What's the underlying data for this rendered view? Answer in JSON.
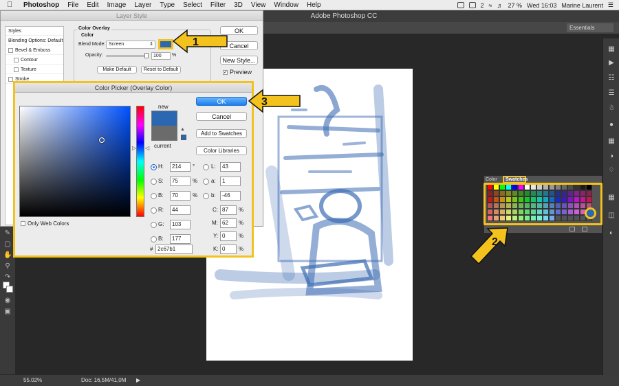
{
  "menubar": {
    "app": "Photoshop",
    "items": [
      "File",
      "Edit",
      "Image",
      "Layer",
      "Type",
      "Select",
      "Filter",
      "3D",
      "View",
      "Window",
      "Help"
    ],
    "battery": "27 %",
    "clock": "Wed 16:03",
    "user": "Marine Laurent",
    "badge": "2"
  },
  "ps": {
    "title": "Adobe Photoshop CC",
    "workspace": "Essentials",
    "status_zoom": "55.02%",
    "status_doc": "Doc: 16,5M/41,0M"
  },
  "layer_style": {
    "title": "Layer Style",
    "list": [
      {
        "label": "Styles",
        "checkbox": false
      },
      {
        "label": "Blending Options: Default",
        "checkbox": false
      },
      {
        "label": "Bevel & Emboss",
        "checkbox": true
      },
      {
        "label": "Contour",
        "checkbox": true
      },
      {
        "label": "Texture",
        "checkbox": true
      },
      {
        "label": "Stroke",
        "checkbox": true
      }
    ],
    "group_title": "Color Overlay",
    "sub_title": "Color",
    "blend_label": "Blend Mode:",
    "blend_value": "Screen",
    "opacity_label": "Opacity:",
    "opacity_value": "100",
    "opacity_unit": "%",
    "make_default": "Make Default",
    "reset_default": "Reset to Default",
    "ok": "OK",
    "cancel": "Cancel",
    "new_style": "New Style...",
    "preview": "Preview",
    "overlay_color": "#2c67b1"
  },
  "picker": {
    "title": "Color Picker (Overlay Color)",
    "new_label": "new",
    "current_label": "current",
    "new_color": "#2c67b1",
    "current_color": "#6b6b6b",
    "ok": "OK",
    "cancel": "Cancel",
    "add_swatches": "Add to Swatches",
    "color_libraries": "Color Libraries",
    "only_web": "Only Web Colors",
    "hsb": [
      {
        "label": "H:",
        "value": "214",
        "unit": "°"
      },
      {
        "label": "S:",
        "value": "75",
        "unit": "%"
      },
      {
        "label": "B:",
        "value": "70",
        "unit": "%"
      }
    ],
    "rgb": [
      {
        "label": "R:",
        "value": "44"
      },
      {
        "label": "G:",
        "value": "103"
      },
      {
        "label": "B:",
        "value": "177"
      }
    ],
    "lab": [
      {
        "label": "L:",
        "value": "43"
      },
      {
        "label": "a:",
        "value": "1"
      },
      {
        "label": "b:",
        "value": "-46"
      }
    ],
    "cmyk": [
      {
        "label": "C:",
        "value": "87",
        "unit": "%"
      },
      {
        "label": "M:",
        "value": "62",
        "unit": "%"
      },
      {
        "label": "Y:",
        "value": "0",
        "unit": "%"
      },
      {
        "label": "K:",
        "value": "0",
        "unit": "%"
      }
    ],
    "hex_label": "#",
    "hex_value": "2c67b1"
  },
  "swatches": {
    "tabs": [
      "Color",
      "Swatches"
    ]
  },
  "callouts": [
    "1",
    "2",
    "3"
  ],
  "accent": "#f4c21c"
}
